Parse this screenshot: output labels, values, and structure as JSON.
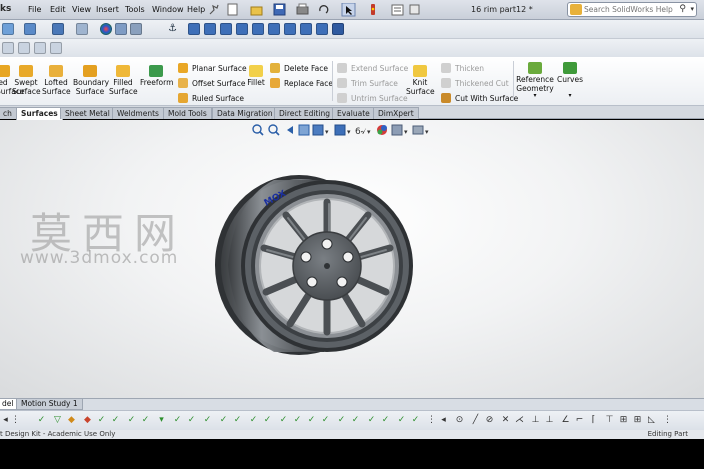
{
  "titlebar": {
    "app_name": "ks",
    "menu": [
      "File",
      "Edit",
      "View",
      "Insert",
      "Tools",
      "Window",
      "Help"
    ],
    "document_title": "16 rim part12 *",
    "search_placeholder": "Search SolidWorks Help"
  },
  "ribbon": {
    "large_commands": [
      {
        "lines": [
          "ed",
          "Surface"
        ],
        "icon": "extruded-surface-icon"
      },
      {
        "lines": [
          "Swept",
          "Surface"
        ],
        "icon": "swept-surface-icon"
      },
      {
        "lines": [
          "Lofted",
          "Surface"
        ],
        "icon": "lofted-surface-icon"
      },
      {
        "lines": [
          "Boundary",
          "Surface"
        ],
        "icon": "boundary-surface-icon"
      },
      {
        "lines": [
          "Filled",
          "Surface"
        ],
        "icon": "filled-surface-icon"
      },
      {
        "lines": [
          "Freeform",
          ""
        ],
        "icon": "freeform-icon"
      },
      {
        "lines": [
          "Fillet",
          ""
        ],
        "icon": "fillet-icon"
      },
      {
        "lines": [
          "Knit",
          "Surface"
        ],
        "icon": "knit-surface-icon"
      },
      {
        "lines": [
          "Reference",
          "Geometry"
        ],
        "icon": "reference-geometry-icon"
      },
      {
        "lines": [
          "Curves",
          ""
        ],
        "icon": "curves-icon"
      }
    ],
    "surface_group": [
      "Planar Surface",
      "Offset Surface",
      "Ruled Surface"
    ],
    "face_group": [
      "Delete Face",
      "Replace Face"
    ],
    "trim_group": [
      "Extend Surface",
      "Trim Surface",
      "Untrim Surface"
    ],
    "thicken_group": [
      "Thicken",
      "Thickened Cut",
      "Cut With Surface"
    ]
  },
  "tabs": {
    "items": [
      "ch",
      "Surfaces",
      "Sheet Metal",
      "Weldments",
      "Mold Tools",
      "Data Migration",
      "Direct Editing",
      "Evaluate",
      "DimXpert"
    ],
    "active": "Surfaces"
  },
  "viewport": {
    "watermark_cn": "莫西网",
    "watermark_url": "www.3dmox.com",
    "rim_logo_text": "MOX"
  },
  "model_tabs": {
    "items": [
      "del",
      "Motion Study 1"
    ],
    "active": "del"
  },
  "statusbar": {
    "left": "t Design Kit - Academic Use Only",
    "right": "Editing Part"
  },
  "colors": {
    "wheel_dark": "#3f4347",
    "wheel_mid": "#5e6368",
    "wheel_light": "#8a8f94",
    "logo_blue": "#1a2fa0"
  }
}
